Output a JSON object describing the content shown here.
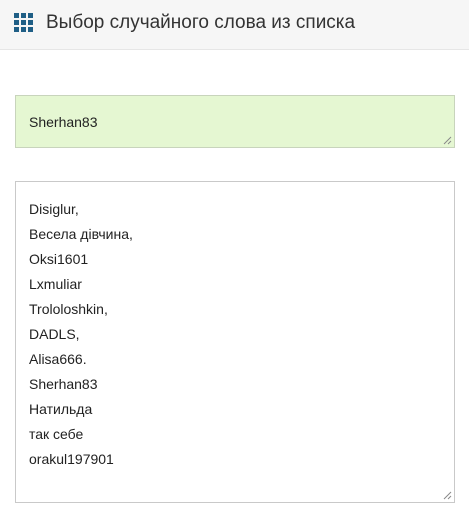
{
  "header": {
    "icon": "grid-icon",
    "title": "Выбор случайного слова из списка"
  },
  "result": {
    "value": "Sherhan83"
  },
  "word_list": {
    "items": [
      "Disiglur,",
      "Весела дівчина,",
      "Oksi1601",
      "Lxmuliar",
      "Trololoshkin,",
      "DADLS,",
      "Alisa666.",
      "Sherhan83",
      "Натильда",
      "так себе",
      "orakul197901"
    ]
  },
  "colors": {
    "accent": "#1f5f86",
    "result_bg": "#e5f7d2"
  }
}
